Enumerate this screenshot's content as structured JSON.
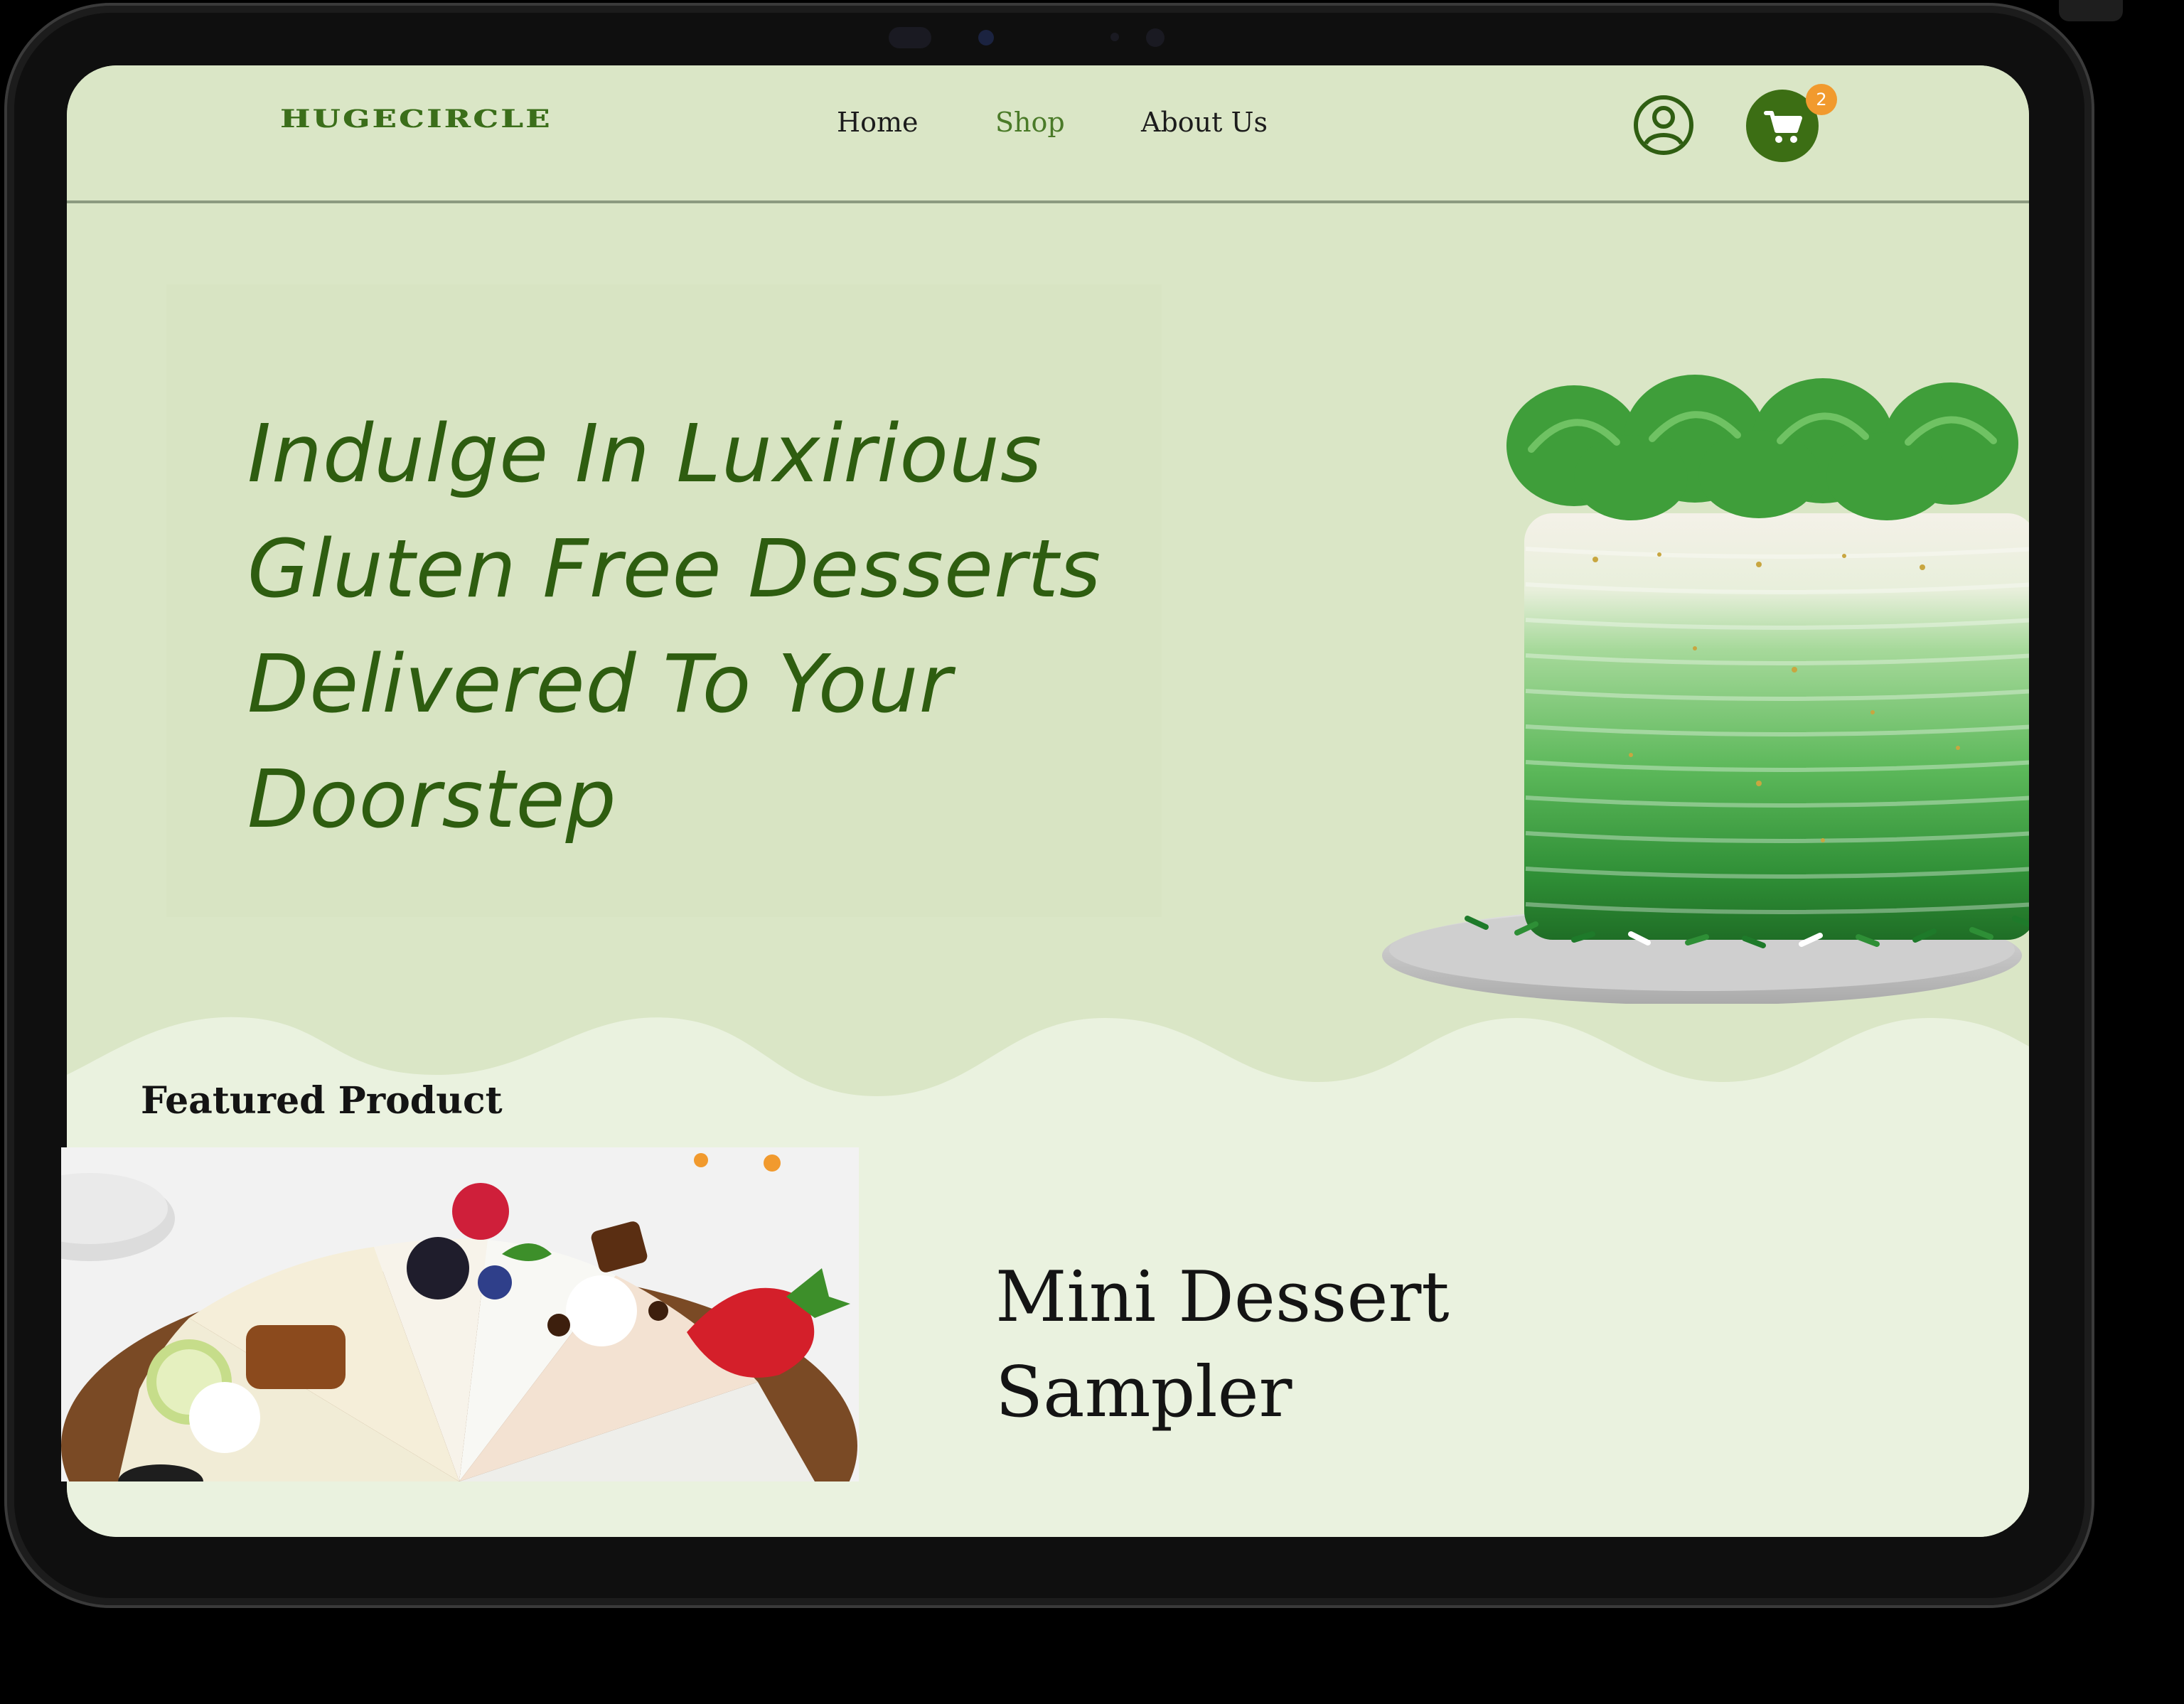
{
  "brand": {
    "logo_text": "HUGECIRCLE",
    "accent_color": "#3c6e14",
    "background_color": "#dae6c6"
  },
  "nav": {
    "items": [
      {
        "label": "Home",
        "active": false
      },
      {
        "label": "Shop",
        "active": true
      },
      {
        "label": "About Us",
        "active": false
      }
    ]
  },
  "header_actions": {
    "account_icon": "user-circle-icon",
    "cart_icon": "shopping-cart-icon",
    "cart_count": "2"
  },
  "hero": {
    "title": "Indulge In Luxirious Gluten Free Desserts Delivered To Your Doorstep",
    "image": "green-ombre-layer-cake"
  },
  "featured": {
    "section_label": "Featured Product",
    "product_name": "Mini Dessert Sampler",
    "image": "dessert-sampler-slices"
  }
}
